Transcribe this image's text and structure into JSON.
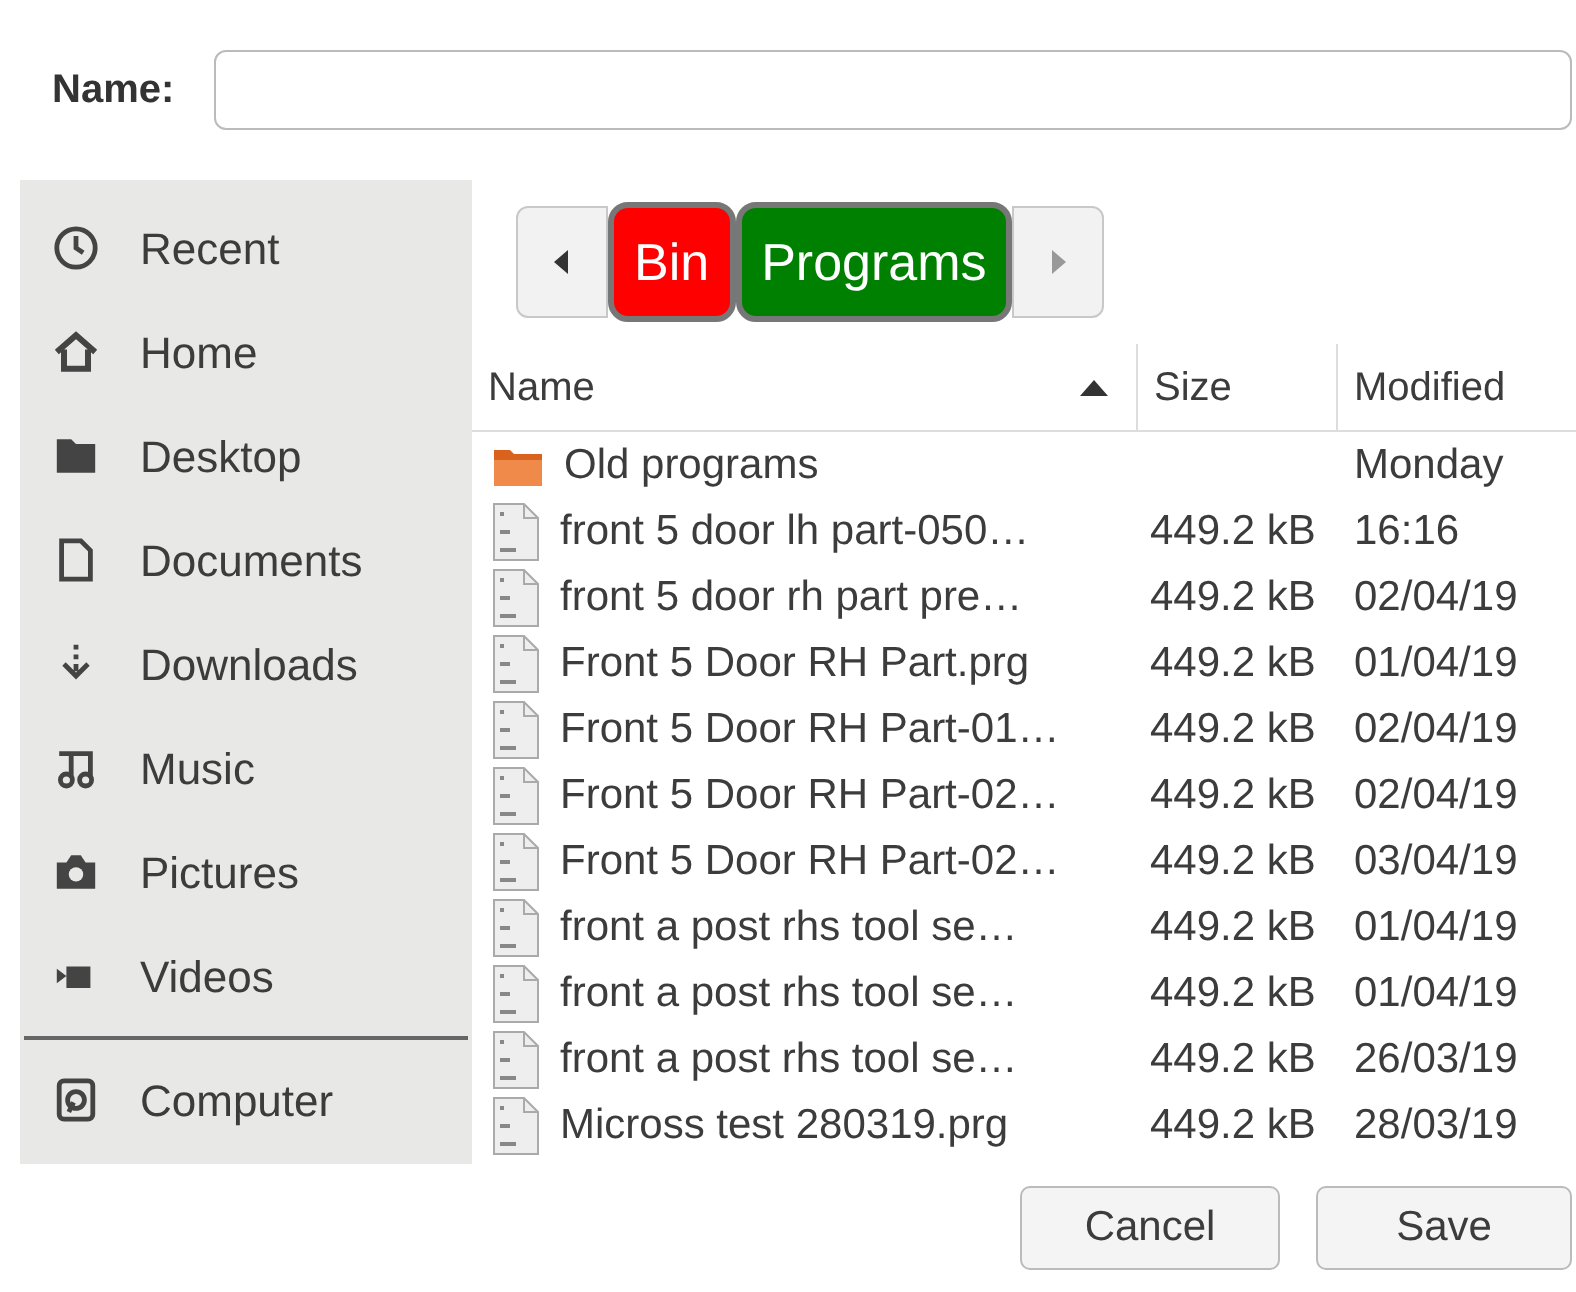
{
  "name_field": {
    "label": "Name:"
  },
  "sidebar": {
    "items": [
      {
        "label": "Recent",
        "kind": "recent"
      },
      {
        "label": "Home",
        "kind": "home"
      },
      {
        "label": "Desktop",
        "kind": "desktop"
      },
      {
        "label": "Documents",
        "kind": "documents"
      },
      {
        "label": "Downloads",
        "kind": "downloads"
      },
      {
        "label": "Music",
        "kind": "music"
      },
      {
        "label": "Pictures",
        "kind": "pictures"
      },
      {
        "label": "Videos",
        "kind": "videos"
      },
      {
        "label": "Computer",
        "kind": "computer"
      }
    ]
  },
  "path_bar": [
    {
      "label": "Bin",
      "color": "#ff0000"
    },
    {
      "label": "Programs",
      "color": "#008000"
    }
  ],
  "table": {
    "columns": [
      "Name",
      "Size",
      "Modified"
    ],
    "rows": [
      {
        "kind": "folder",
        "name": "Old programs",
        "modified": "Monday"
      },
      {
        "kind": "file",
        "name": "front 5 door lh part-050…",
        "size": "449.2 kB",
        "modified": "16:16"
      },
      {
        "kind": "file",
        "name": "front 5 door rh part pre…",
        "size": "449.2 kB",
        "modified": "02/04/19"
      },
      {
        "kind": "file",
        "name": "Front 5 Door RH Part.prg",
        "size": "449.2 kB",
        "modified": "01/04/19"
      },
      {
        "kind": "file",
        "name": "Front 5 Door RH Part-01…",
        "size": "449.2 kB",
        "modified": "02/04/19"
      },
      {
        "kind": "file",
        "name": "Front 5 Door RH Part-02…",
        "size": "449.2 kB",
        "modified": "02/04/19"
      },
      {
        "kind": "file",
        "name": "Front 5 Door RH Part-02…",
        "size": "449.2 kB",
        "modified": "03/04/19"
      },
      {
        "kind": "file",
        "name": "front  a post rhs tool se…",
        "size": "449.2 kB",
        "modified": "01/04/19"
      },
      {
        "kind": "file",
        "name": "front a post rhs tool se…",
        "size": "449.2 kB",
        "modified": "01/04/19"
      },
      {
        "kind": "file",
        "name": "front a post rhs tool se…",
        "size": "449.2 kB",
        "modified": "26/03/19"
      },
      {
        "kind": "file",
        "name": "Micross test 280319.prg",
        "size": "449.2 kB",
        "modified": "28/03/19"
      }
    ]
  },
  "buttons": [
    "Cancel",
    "Save"
  ]
}
